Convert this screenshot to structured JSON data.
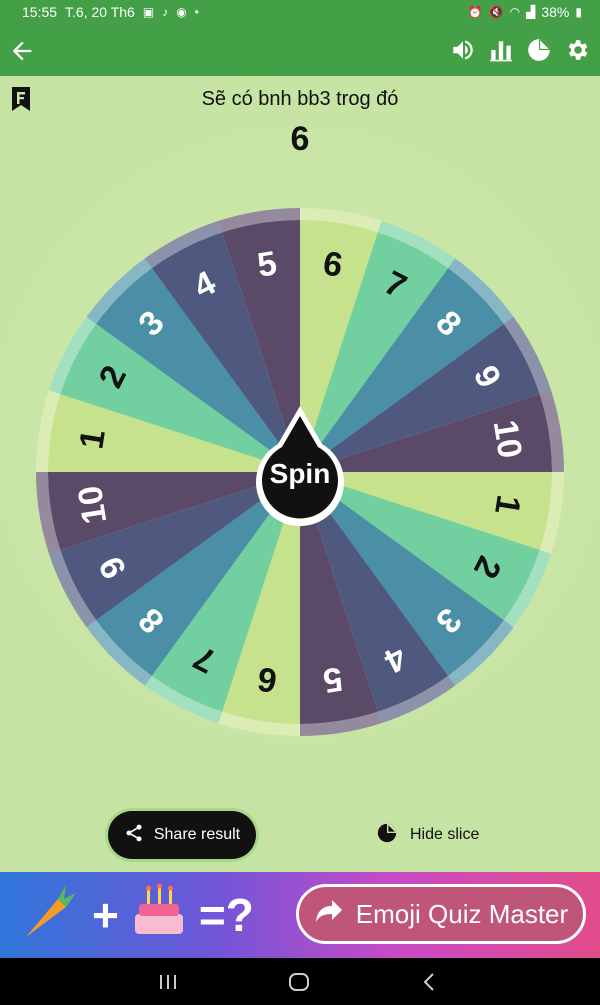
{
  "status_bar": {
    "time": "15:55",
    "date": "T.6, 20 Th6",
    "battery": "38%"
  },
  "app_bar": {
    "icons": [
      "back-arrow-icon",
      "volume-icon",
      "stats-icon",
      "pie-chart-icon",
      "settings-icon"
    ]
  },
  "header": {
    "title": "Sẽ có bnh bb3 trog đó",
    "result": "6"
  },
  "wheel": {
    "spin_label": "Spin",
    "slices": [
      {
        "label": "6",
        "color": "#c7e28d"
      },
      {
        "label": "7",
        "color": "#72cfa0"
      },
      {
        "label": "8",
        "color": "#4a8fa5"
      },
      {
        "label": "9",
        "color": "#4f587e"
      },
      {
        "label": "10",
        "color": "#5a4a68"
      },
      {
        "label": "1",
        "color": "#c7e28d"
      },
      {
        "label": "2",
        "color": "#72cfa0"
      },
      {
        "label": "3",
        "color": "#4a8fa5"
      },
      {
        "label": "4",
        "color": "#4f587e"
      },
      {
        "label": "5",
        "color": "#5a4a68"
      },
      {
        "label": "6",
        "color": "#c7e28d"
      },
      {
        "label": "7",
        "color": "#72cfa0"
      },
      {
        "label": "8",
        "color": "#4a8fa5"
      },
      {
        "label": "9",
        "color": "#4f587e"
      },
      {
        "label": "10",
        "color": "#5a4a68"
      },
      {
        "label": "1",
        "color": "#c7e28d"
      },
      {
        "label": "2",
        "color": "#72cfa0"
      },
      {
        "label": "3",
        "color": "#4a8fa5"
      },
      {
        "label": "4",
        "color": "#4f587e"
      },
      {
        "label": "5",
        "color": "#5a4a68"
      }
    ]
  },
  "actions": {
    "share_label": "Share result",
    "hide_label": "Hide slice"
  },
  "ad": {
    "plus": "+",
    "equals": "=?",
    "button_label": "Emoji Quiz Master"
  }
}
